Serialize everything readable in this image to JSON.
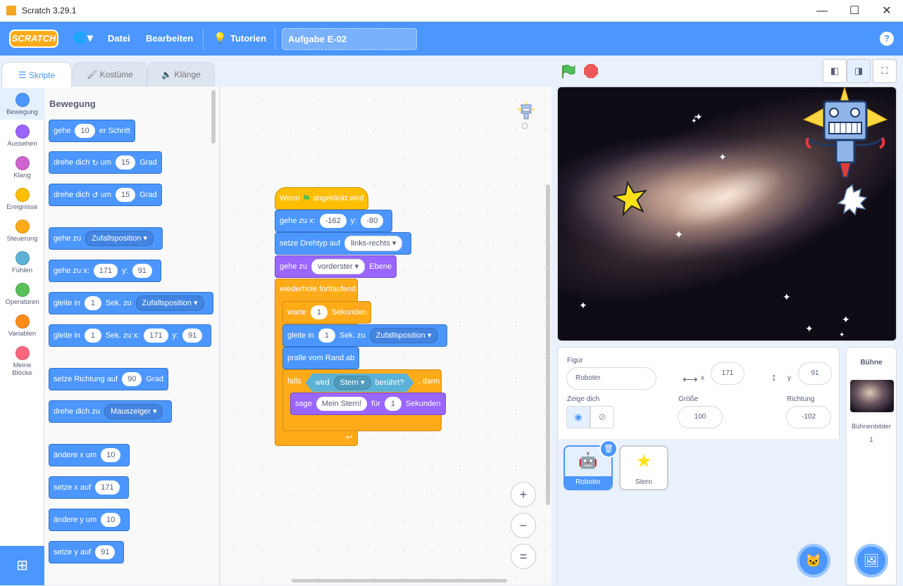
{
  "window": {
    "title": "Scratch 3.29.1",
    "min": "—",
    "max": "☐",
    "close": "✕"
  },
  "menu": {
    "logo": "SCRATCH",
    "language_icon": "globe-icon",
    "file": "Datei",
    "edit": "Bearbeiten",
    "tutorials": "Tutorien",
    "project_title": "Aufgabe E-02",
    "help": "?"
  },
  "tabs": {
    "code": "Skripte",
    "costumes": "Kostüme",
    "sounds": "Klänge"
  },
  "categories": [
    {
      "label": "Bewegung",
      "color": "#4c97ff"
    },
    {
      "label": "Aussehen",
      "color": "#9966ff"
    },
    {
      "label": "Klang",
      "color": "#cf63cf"
    },
    {
      "label": "Ereignisse",
      "color": "#ffbf00"
    },
    {
      "label": "Steuerung",
      "color": "#ffab19"
    },
    {
      "label": "Fühlen",
      "color": "#5cb1d6"
    },
    {
      "label": "Operatoren",
      "color": "#59c059"
    },
    {
      "label": "Variablen",
      "color": "#ff8c1a"
    },
    {
      "label": "Meine Blöcke",
      "color": "#ff6680"
    }
  ],
  "palette": {
    "heading": "Bewegung",
    "b1": {
      "t1": "gehe",
      "v1": "10",
      "t2": "er Schritt"
    },
    "b2": {
      "t1": "drehe dich",
      "t2": "um",
      "v1": "15",
      "t3": "Grad"
    },
    "b3": {
      "t1": "drehe dich",
      "t2": "um",
      "v1": "15",
      "t3": "Grad"
    },
    "b4": {
      "t1": "gehe zu",
      "d1": "Zufallsposition"
    },
    "b5": {
      "t1": "gehe zu x:",
      "v1": "171",
      "t2": "y:",
      "v2": "91"
    },
    "b6": {
      "t1": "gleite in",
      "v1": "1",
      "t2": "Sek. zu",
      "d1": "Zufallsposition"
    },
    "b7": {
      "t1": "gleite in",
      "v1": "1",
      "t2": "Sek. zu x:",
      "v2": "171",
      "t3": "y:",
      "v3": "91"
    },
    "b8": {
      "t1": "setze Richtung auf",
      "v1": "90",
      "t2": "Grad"
    },
    "b9": {
      "t1": "drehe dich zu",
      "d1": "Mauszeiger"
    },
    "b10": {
      "t1": "ändere x um",
      "v1": "10"
    },
    "b11": {
      "t1": "setze x auf",
      "v1": "171"
    },
    "b12": {
      "t1": "ändere y um",
      "v1": "10"
    },
    "b13": {
      "t1": "setze y auf",
      "v1": "91"
    }
  },
  "script": {
    "hat": {
      "t1": "Wenn",
      "t2": "angeklickt wird"
    },
    "goto": {
      "t1": "gehe zu x:",
      "v1": "-162",
      "t2": "y:",
      "v2": "-80"
    },
    "rot": {
      "t1": "setze Drehtyp auf",
      "d1": "links-rechts"
    },
    "layer": {
      "t1": "gehe zu",
      "d1": "vorderster",
      "t2": "Ebene"
    },
    "forever": "wiederhole fortlaufend",
    "wait": {
      "t1": "warte",
      "v1": "1",
      "t2": "Sekunden"
    },
    "glide": {
      "t1": "gleite in",
      "v1": "1",
      "t2": "Sek. zu",
      "d1": "Zufallsposition"
    },
    "bounce": "pralle vom Rand ab",
    "if": {
      "t1": "falls",
      "s1": "wird",
      "sd": "Stern",
      "s2": "berührt?",
      "t2": ", dann"
    },
    "say": {
      "t1": "sage",
      "v1": "Mein Stern!",
      "t2": "für",
      "v2": "1",
      "t3": "Sekunden"
    }
  },
  "zoom": {
    "in": "+",
    "out": "−",
    "reset": "="
  },
  "sprite": {
    "label": "Figur",
    "name": "Roboter",
    "x_label": "x",
    "x": "171",
    "y_label": "y",
    "y": "91",
    "show_label": "Zeige dich",
    "size_label": "Größe",
    "size": "100",
    "dir_label": "Richtung",
    "direction": "-102"
  },
  "sprites": [
    {
      "name": "Roboter"
    },
    {
      "name": "Stern"
    }
  ],
  "stage_panel": {
    "title": "Bühne",
    "backdrops_label": "Bühnenbilder",
    "backdrops_count": "1"
  }
}
